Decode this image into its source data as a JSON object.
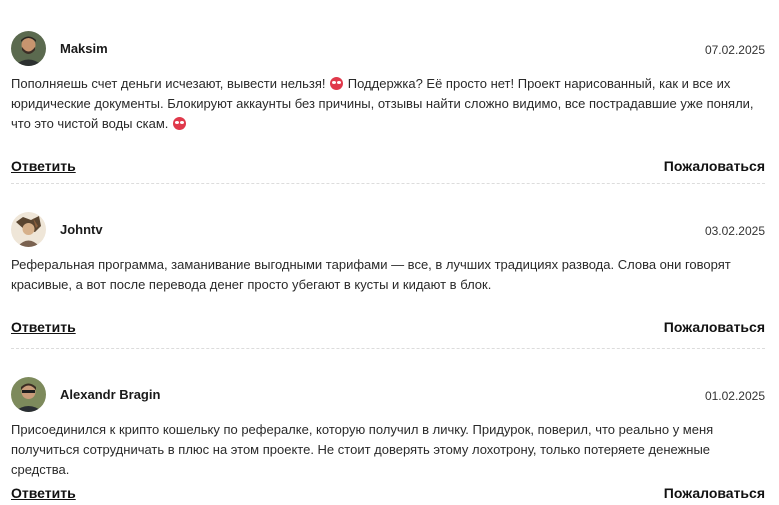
{
  "actions": {
    "reply": "Ответить",
    "report": "Пожаловаться"
  },
  "comments": [
    {
      "author": "Maksim",
      "date": "07.02.2025",
      "text_parts": [
        "Пополняешь счет деньги исчезают, вывести нельзя! ",
        " Поддержка? Её просто нет! Проект нарисованный, как и все их юридические документы. Блокируют аккаунты без причины, отзывы найти сложно видимо, все пострадавшие уже поняли, что это чистой воды скам. "
      ]
    },
    {
      "author": "Johntv",
      "date": "03.02.2025",
      "text": "Реферальная программа, заманивание выгодными тарифами — все, в лучших традициях развода. Слова они говорят красивые, а вот после перевода денег просто убегают в кусты и кидают в блок."
    },
    {
      "author": "Alexandr Bragin",
      "date": "01.02.2025",
      "text": "Присоединился к крипто кошельку по рефералке, которую получил в личку. Придурок, поверил, что реально у меня получиться сотрудничать в плюс на этом проекте. Не стоит доверять этому лохотрону, только потеряете денежные средства."
    }
  ],
  "icons": {
    "emoji": "angry-face-icon"
  }
}
